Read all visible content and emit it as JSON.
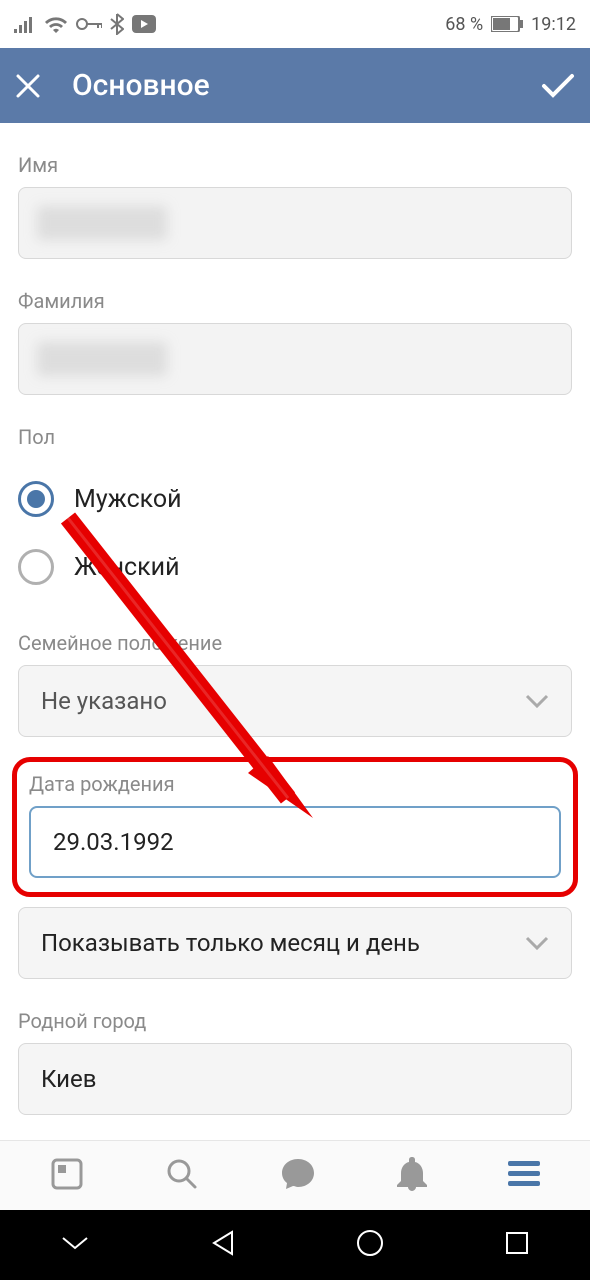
{
  "status": {
    "battery_text": "68 %",
    "time": "19:12"
  },
  "header": {
    "title": "Основное"
  },
  "form": {
    "name_label": "Имя",
    "surname_label": "Фамилия",
    "gender_label": "Пол",
    "gender_options": {
      "male": "Мужской",
      "female": "Женский"
    },
    "relationship_label": "Семейное положение",
    "relationship_value": "Не указано",
    "birthdate_label": "Дата рождения",
    "birthdate_value": "29.03.1992",
    "birthdate_display_value": "Показывать только месяц и день",
    "hometown_label": "Родной город",
    "hometown_value": "Киев"
  }
}
